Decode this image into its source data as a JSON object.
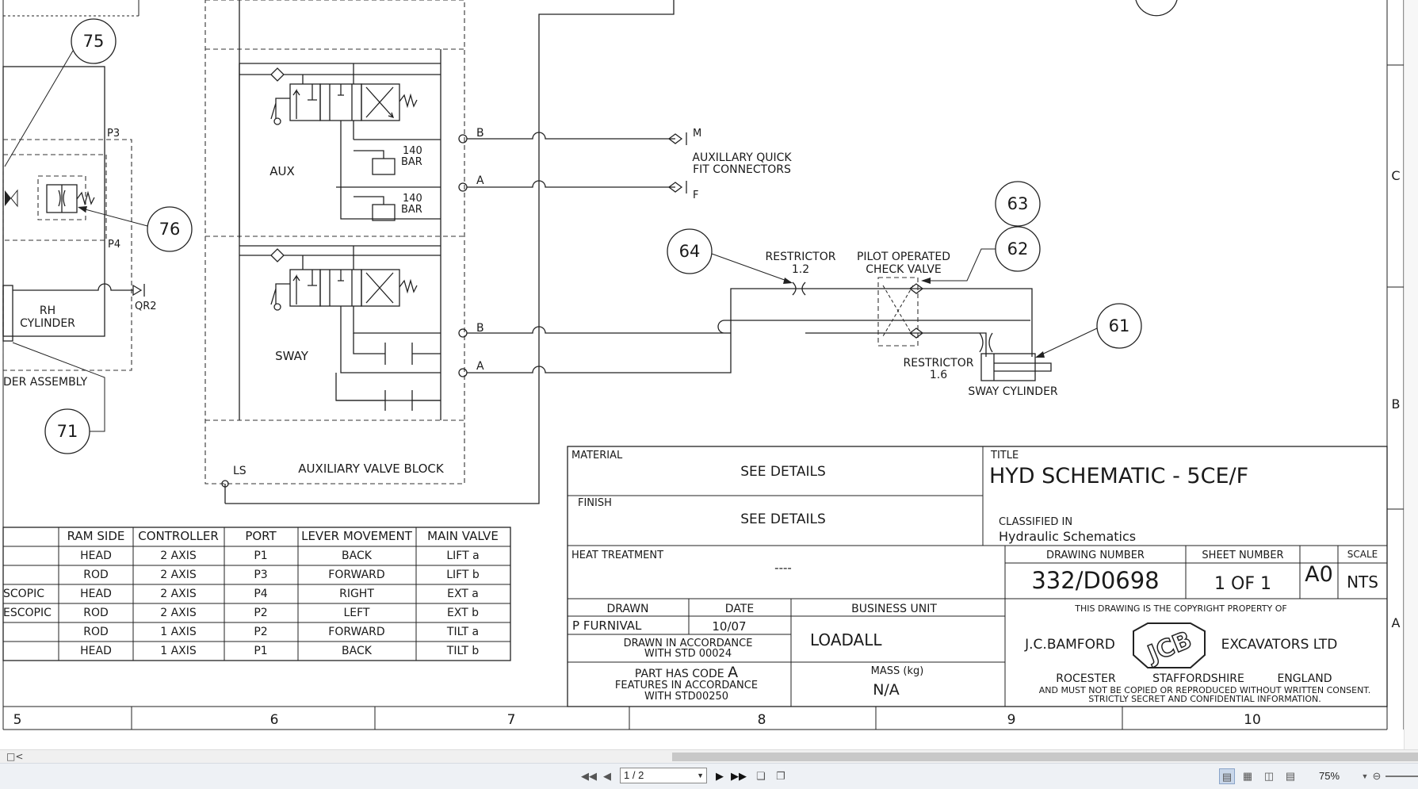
{
  "labels": {
    "ref_75": "75",
    "ref_76": "76",
    "ref_71": "71",
    "ref_64": "64",
    "ref_63": "63",
    "ref_62": "62",
    "ref_61": "61",
    "p3": "P3",
    "p4": "P4",
    "qr2": "QR2",
    "rh_cylinder_1": "RH",
    "rh_cylinder_2": "CYLINDER",
    "assembly": "DER ASSEMBLY",
    "aux": "AUX",
    "sway": "SWAY",
    "ls": "LS",
    "aux_valve_block": "AUXILIARY VALVE BLOCK",
    "b": "B",
    "a": "A",
    "bar_value": "140",
    "bar_unit": "BAR",
    "port_m": "M",
    "port_f": "F",
    "aux_connectors_1": "AUXILLARY QUICK",
    "aux_connectors_2": "FIT CONNECTORS",
    "restrictor": "RESTRICTOR",
    "restrictor_1_2": "1.2",
    "restrictor_1_6": "1.6",
    "pilot_1": "PILOT OPERATED",
    "pilot_2": "CHECK VALVE",
    "sway_cylinder": "SWAY CYLINDER"
  },
  "valve_table": {
    "headers": [
      "",
      "RAM SIDE",
      "CONTROLLER",
      "PORT",
      "LEVER MOVEMENT",
      "MAIN VALVE"
    ],
    "rows": [
      [
        "",
        "HEAD",
        "2 AXIS",
        "P1",
        "BACK",
        "LIFT a"
      ],
      [
        "",
        "ROD",
        "2 AXIS",
        "P3",
        "FORWARD",
        "LIFT b"
      ],
      [
        "SCOPIC",
        "HEAD",
        "2 AXIS",
        "P4",
        "RIGHT",
        "EXT a"
      ],
      [
        "ESCOPIC",
        "ROD",
        "2 AXIS",
        "P2",
        "LEFT",
        "EXT b"
      ],
      [
        "",
        "ROD",
        "1 AXIS",
        "P2",
        "FORWARD",
        "TILT a"
      ],
      [
        "",
        "HEAD",
        "1 AXIS",
        "P1",
        "BACK",
        "TILT b"
      ]
    ]
  },
  "title_block": {
    "material_label": "MATERIAL",
    "material_value": "SEE DETAILS",
    "finish_label": "FINISH",
    "finish_value": "SEE DETAILS",
    "title_label": "TITLE",
    "title_value": "HYD SCHEMATIC - 5CE/F",
    "classified_label": "CLASSIFIED IN",
    "classified_value": "Hydraulic Schematics",
    "heat_label": "HEAT TREATMENT",
    "heat_value": "----",
    "drawing_number_label": "DRAWING NUMBER",
    "drawing_number_value": "332/D0698",
    "sheet_label": "SHEET NUMBER",
    "sheet_value": "1 OF 1",
    "size_value": "A0",
    "scale_label": "SCALE",
    "scale_value": "NTS",
    "drawn_label": "DRAWN",
    "drawn_value": "P FURNIVAL",
    "date_label": "DATE",
    "date_value": "10/07",
    "bu_label": "BUSINESS UNIT",
    "bu_value": "LOADALL",
    "accordance_1": "DRAWN IN ACCORDANCE",
    "accordance_2": "WITH STD 00024",
    "part_code_1": "PART HAS CODE",
    "part_code_letter": "A",
    "part_code_2": "FEATURES IN ACCORDANCE",
    "part_code_3": "WITH STD00250",
    "mass_label": "MASS (kg)",
    "mass_value": "N/A",
    "copyright": "THIS DRAWING IS THE COPYRIGHT PROPERTY OF",
    "company_left": "J.C.BAMFORD",
    "company_right": "EXCAVATORS LTD",
    "logo_text": "JCB",
    "loc_1": "ROCESTER",
    "loc_2": "STAFFORDSHIRE",
    "loc_3": "ENGLAND",
    "notice_1": "AND MUST NOT BE COPIED OR REPRODUCED WITHOUT WRITTEN CONSENT.",
    "notice_2": "STRICTLY SECRET AND CONFIDENTIAL INFORMATION."
  },
  "grid": {
    "columns": [
      "5",
      "6",
      "7",
      "8",
      "9",
      "10"
    ],
    "rows": [
      "C",
      "B",
      "A"
    ]
  },
  "viewer": {
    "page_value": "1 / 2",
    "zoom": "75%"
  }
}
